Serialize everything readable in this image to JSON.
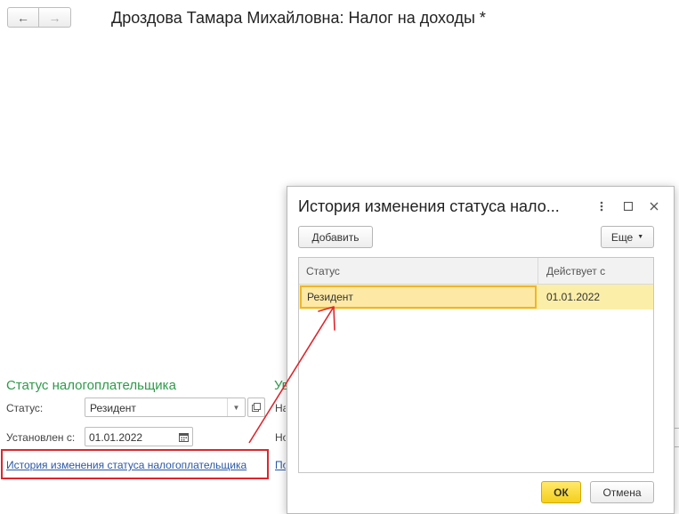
{
  "nav": {
    "back_icon": "←",
    "forward_icon": "→"
  },
  "page": {
    "title": "Дроздова Тамара Михайловна: Налог на доходы *"
  },
  "taxpayer_status": {
    "section_title": "Статус налогоплательщика",
    "status_label": "Статус:",
    "status_value": "Резидент",
    "set_from_label": "Установлен с:",
    "set_from_value": "01.01.2022",
    "history_link": "История изменения статуса налогоплательщика"
  },
  "side_fragments": {
    "section_title": "Ув",
    "row1": "На",
    "row2": "Но",
    "link": "По"
  },
  "dialog": {
    "title": "История изменения статуса нало...",
    "add_button": "Добавить",
    "more_button": "Еще",
    "columns": {
      "status": "Статус",
      "valid_from": "Действует с"
    },
    "rows": [
      {
        "status": "Резидент",
        "valid_from": "01.01.2022"
      }
    ],
    "ok_button": "ОК",
    "cancel_button": "Отмена"
  },
  "colors": {
    "accent_green": "#2e9a4a",
    "link_blue": "#2a58a6",
    "highlight_red": "#e0242c",
    "selection_yellow": "#fbeea9",
    "ok_yellow": "#f5cf1b"
  }
}
